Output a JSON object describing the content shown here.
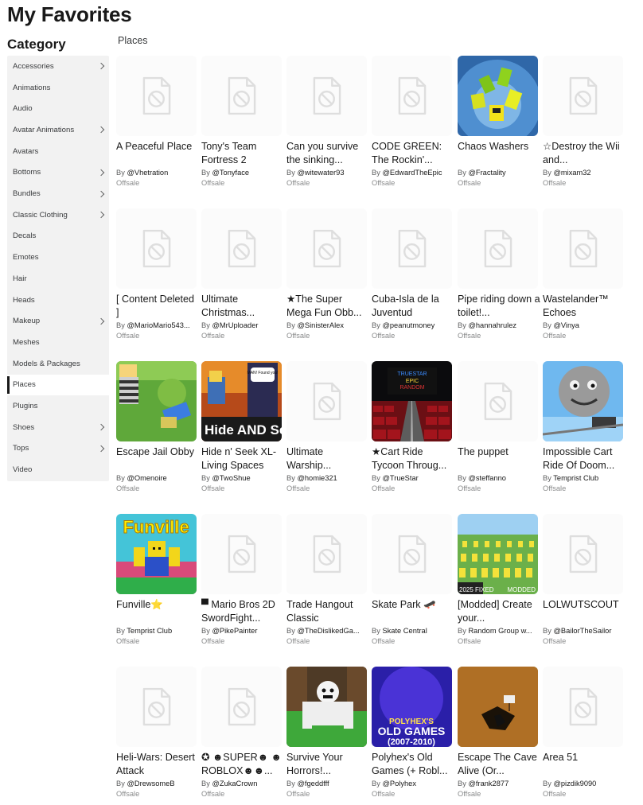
{
  "page": {
    "title": "My Favorites"
  },
  "sidebar": {
    "heading": "Category",
    "items": [
      {
        "label": "Accessories",
        "chevron": true
      },
      {
        "label": "Animations",
        "chevron": false
      },
      {
        "label": "Audio",
        "chevron": false
      },
      {
        "label": "Avatar Animations",
        "chevron": true
      },
      {
        "label": "Avatars",
        "chevron": false
      },
      {
        "label": "Bottoms",
        "chevron": true
      },
      {
        "label": "Bundles",
        "chevron": true
      },
      {
        "label": "Classic Clothing",
        "chevron": true
      },
      {
        "label": "Decals",
        "chevron": false
      },
      {
        "label": "Emotes",
        "chevron": false
      },
      {
        "label": "Hair",
        "chevron": false
      },
      {
        "label": "Heads",
        "chevron": false
      },
      {
        "label": "Makeup",
        "chevron": true
      },
      {
        "label": "Meshes",
        "chevron": false
      },
      {
        "label": "Models & Packages",
        "chevron": false
      },
      {
        "label": "Places",
        "chevron": false,
        "active": true
      },
      {
        "label": "Plugins",
        "chevron": false
      },
      {
        "label": "Shoes",
        "chevron": true
      },
      {
        "label": "Tops",
        "chevron": true
      },
      {
        "label": "Video",
        "chevron": false
      }
    ]
  },
  "main": {
    "section_label": "Places",
    "by_label": "By",
    "cards": [
      {
        "name": "A Peaceful Place",
        "creator": "@Vhetration",
        "price": "Offsale",
        "thumb": "placeholder"
      },
      {
        "name": "Tony's Team Fortress 2",
        "creator": "@Tonyface",
        "price": "Offsale",
        "thumb": "placeholder"
      },
      {
        "name": "Can you survive the sinking...",
        "creator": "@witewater93",
        "price": "Offsale",
        "thumb": "placeholder"
      },
      {
        "name": "CODE GREEN: The Rockin'...",
        "creator": "@EdwardTheEpic",
        "price": "Offsale",
        "thumb": "placeholder"
      },
      {
        "name": "Chaos Washers",
        "creator": "@Fractality",
        "price": "Offsale",
        "thumb": "chaos"
      },
      {
        "name": "☆Destroy the Wii and...",
        "creator": "@mixam32",
        "price": "Offsale",
        "thumb": "placeholder"
      },
      {
        "name": "[ Content Deleted ]",
        "creator": "@MarioMario543...",
        "price": "Offsale",
        "thumb": "placeholder"
      },
      {
        "name": "Ultimate Christmas...",
        "creator": "@MrUploader",
        "price": "Offsale",
        "thumb": "placeholder"
      },
      {
        "name": "★The Super Mega Fun Obb...",
        "creator": "@SinisterAlex",
        "price": "Offsale",
        "thumb": "placeholder"
      },
      {
        "name": "Cuba-Isla de la Juventud",
        "creator": "@peanutmoney",
        "price": "Offsale",
        "thumb": "placeholder"
      },
      {
        "name": "Pipe riding down a toilet!...",
        "creator": "@hannahrulez",
        "price": "Offsale",
        "thumb": "placeholder"
      },
      {
        "name": "Wastelander™ Echoes",
        "creator": "@Vinya",
        "price": "Offsale",
        "thumb": "placeholder"
      },
      {
        "name": "Escape Jail Obby",
        "creator": "@Omenoire",
        "price": "Offsale",
        "thumb": "jail"
      },
      {
        "name": "Hide n' Seek XL- Living Spaces",
        "creator": "@TwoShue",
        "price": "Offsale",
        "thumb": "hide"
      },
      {
        "name": "Ultimate Warship...",
        "creator": "@homie321",
        "price": "Offsale",
        "thumb": "placeholder"
      },
      {
        "name": "★Cart Ride Tycoon Throug...",
        "creator": "@TrueStar",
        "price": "Offsale",
        "thumb": "cart"
      },
      {
        "name": "The puppet",
        "creator": "@steffanno",
        "price": "Offsale",
        "thumb": "placeholder"
      },
      {
        "name": "Impossible Cart Ride Of Doom...",
        "creator": "Temprist Club",
        "price": "Offsale",
        "thumb": "doom"
      },
      {
        "name": "Funville⭐",
        "creator": "Temprist Club",
        "price": "Offsale",
        "thumb": "funville"
      },
      {
        "name": "▀ Mario Bros 2D SwordFight...",
        "creator": "@PikePainter",
        "price": "Offsale",
        "thumb": "placeholder"
      },
      {
        "name": "Trade Hangout Classic",
        "creator": "@TheDislikedGa...",
        "price": "Offsale",
        "thumb": "placeholder"
      },
      {
        "name": "Skate Park 🛹",
        "creator": "Skate Central",
        "price": "Offsale",
        "thumb": "placeholder"
      },
      {
        "name": "[Modded] Create your...",
        "creator": "Random Group w...",
        "price": "Offsale",
        "thumb": "modded"
      },
      {
        "name": "LOLWUTSCOUT",
        "creator": "@BailorTheSailor",
        "price": "Offsale",
        "thumb": "placeholder"
      },
      {
        "name": "Heli-Wars: Desert Attack",
        "creator": "@DrewsomeB",
        "price": "Offsale",
        "thumb": "placeholder"
      },
      {
        "name": "✪ ☻SUPER☻ ☻ ROBLOX☻☻...",
        "creator": "@ZukaCrown",
        "price": "Offsale",
        "thumb": "placeholder"
      },
      {
        "name": "Survive Your Horrors!...",
        "creator": "@fgeddfff",
        "price": "Offsale",
        "thumb": "horrors"
      },
      {
        "name": "Polyhex's Old Games (+ Robl...",
        "creator": "@Polyhex",
        "price": "Offsale",
        "thumb": "polyhex"
      },
      {
        "name": "Escape The Cave Alive (Or...",
        "creator": "@frank2877",
        "price": "Offsale",
        "thumb": "cave"
      },
      {
        "name": "Area 51",
        "creator": "@pizdik9090",
        "price": "Offsale",
        "thumb": "placeholder"
      }
    ],
    "thumb_texts": {
      "hide_top": "MAN! Found you!",
      "hide_bottom": "Hide AND Seek",
      "cart_1": "TRUESTAR",
      "cart_2": "EPIC",
      "cart_3": "RANDOM",
      "funville": "Funville",
      "modded_left": "2025 FIXED",
      "modded_right": "MODDED",
      "polyhex_1": "POLYHEX'S",
      "polyhex_2": "OLD GAMES",
      "polyhex_3": "(2007-2010)"
    }
  }
}
